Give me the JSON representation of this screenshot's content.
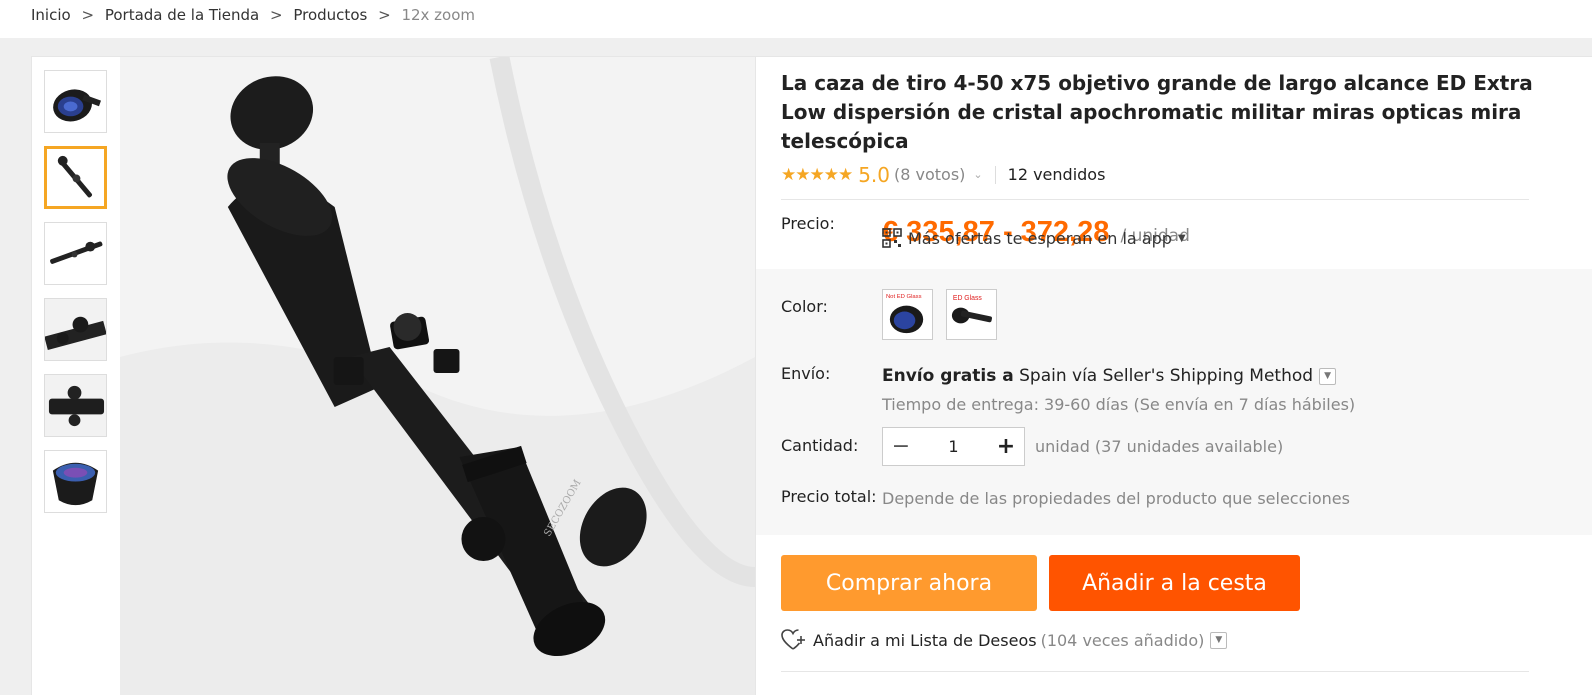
{
  "breadcrumb": {
    "items": [
      "Inicio",
      "Portada de la Tienda",
      "Productos"
    ],
    "current": "12x zoom",
    "separator": ">"
  },
  "product": {
    "title": "La caza de tiro 4-50 x75 objetivo grande de largo alcance ED Extra Low dispersión de cristal apochromatic militar miras opticas mira telescópica",
    "stars": "★★★★★",
    "score": "5.0",
    "votes": "(8 votos)",
    "sold": "12 vendidos",
    "rating": 5.0
  },
  "price": {
    "label": "Precio:",
    "value": "€ 335,87 - 372,28",
    "unit": "/ unidad",
    "app_offers": "Más ofertas te esperan en la app"
  },
  "color": {
    "label": "Color:",
    "options": [
      "Not ED Glass",
      "ED Glass"
    ]
  },
  "shipping": {
    "label": "Envío:",
    "main_bold": "Envío gratis a",
    "main_rest": "Spain vía Seller's Shipping Method",
    "delivery": "Tiempo de entrega: 39-60 días (Se envía en 7 días hábiles)"
  },
  "quantity": {
    "label": "Cantidad:",
    "value": "1",
    "minus": "−",
    "plus": "+",
    "note": "unidad (37 unidades available)"
  },
  "total": {
    "label": "Precio total:",
    "note": "Depende de las propiedades del producto que selecciones"
  },
  "actions": {
    "buy_now": "Comprar ahora",
    "add_to_cart": "Añadir a la cesta",
    "wishlist": "Añadir a mi Lista de Deseos",
    "wishlist_count": "(104 veces añadido)"
  },
  "colors": {
    "accent_orange": "#ff6a00",
    "buy_button": "#ff9a2e",
    "cart_button": "#ff5400",
    "star": "#f5a623"
  }
}
